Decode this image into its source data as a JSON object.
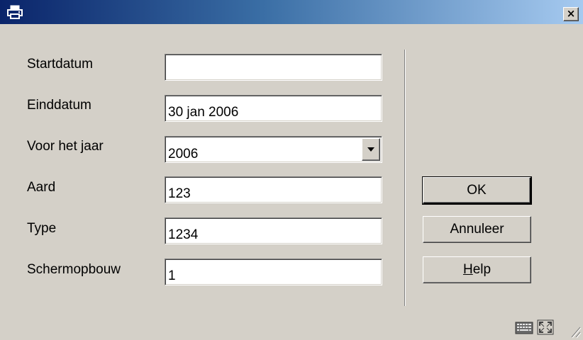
{
  "window": {
    "title_icon": "printer-icon",
    "close_label": "×"
  },
  "form": {
    "fields": [
      {
        "label": "Startdatum",
        "value": ""
      },
      {
        "label": "Einddatum",
        "value": "30 jan 2006"
      },
      {
        "label": "Voor het jaar",
        "value": "2006"
      },
      {
        "label": "Aard",
        "value": "123"
      },
      {
        "label": "Type",
        "value": "1234"
      },
      {
        "label": "Schermopbouw",
        "value": "1"
      }
    ]
  },
  "buttons": {
    "ok": "OK",
    "cancel": "Annuleer",
    "help_first": "H",
    "help_rest": "elp"
  },
  "status_icons": [
    "keyboard-icon",
    "maximize-icon",
    "resize-grip-icon"
  ],
  "colors": {
    "face": "#d4d0c8",
    "title_start": "#0a246a",
    "title_end": "#a6caf0"
  }
}
